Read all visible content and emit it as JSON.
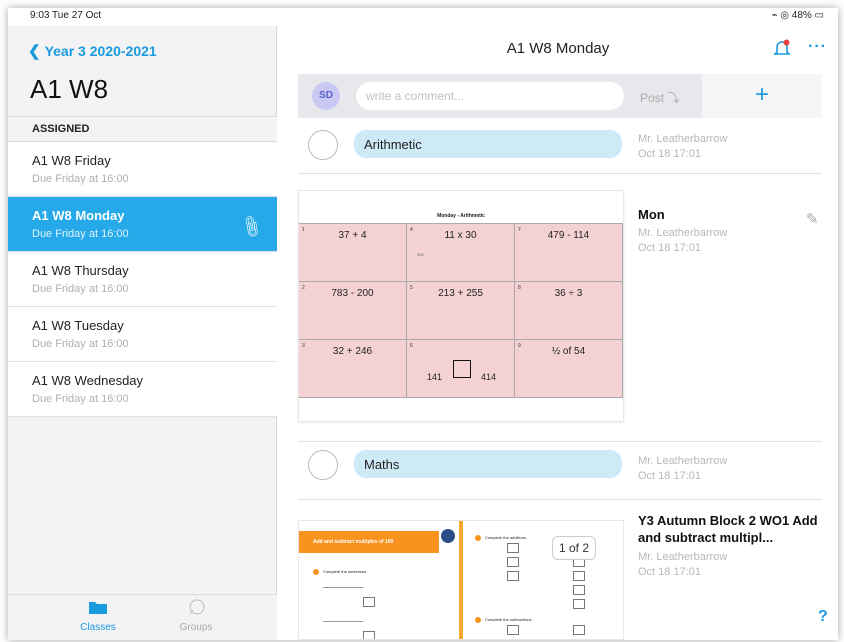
{
  "status": {
    "left": "9:03  Tue 27 Oct",
    "right": "⌁ ◎ 48% ▭"
  },
  "sidebar": {
    "back_label": "Year 3 2020-2021",
    "title": "A1 W8",
    "section_label": "ASSIGNED",
    "items": [
      {
        "title": "A1 W8 Friday",
        "due": "Due Friday at 16:00"
      },
      {
        "title": "A1 W8 Monday",
        "due": "Due Friday at 16:00"
      },
      {
        "title": "A1 W8 Thursday",
        "due": "Due Friday at 16:00"
      },
      {
        "title": "A1 W8 Tuesday",
        "due": "Due Friday at 16:00"
      },
      {
        "title": "A1 W8 Wednesday",
        "due": "Due Friday at 16:00"
      }
    ],
    "tabs": {
      "classes": "Classes",
      "groups": "Groups"
    }
  },
  "header": {
    "title": "A1 W8 Monday",
    "more": "···"
  },
  "comment": {
    "avatar": "SD",
    "placeholder": "write a comment...",
    "post": "Post ⤵",
    "plus": "+"
  },
  "posts": [
    {
      "label": "Arithmetic",
      "author": "Mr. Leatherbarrow",
      "date": "Oct 18 17:01"
    },
    {
      "title": "Mon",
      "author": "Mr. Leatherbarrow",
      "date": "Oct 18 17:01"
    },
    {
      "label": "Maths",
      "author": "Mr. Leatherbarrow",
      "date": "Oct 18 17:01"
    },
    {
      "title": "Y3 Autumn Block 2 WO1 Add and subtract multipl...",
      "author": "Mr. Leatherbarrow",
      "date": "Oct 18 17:01"
    }
  ],
  "worksheet": {
    "title": "Monday - Arithmetic",
    "cells": [
      {
        "n": "1",
        "q": "37 + 4"
      },
      {
        "n": "4",
        "q": "11 x 30",
        "sub": "330"
      },
      {
        "n": "7",
        "q": "479 - 114"
      },
      {
        "n": "2",
        "q": "783 - 200"
      },
      {
        "n": "5",
        "q": "213 + 255"
      },
      {
        "n": "8",
        "q": "36 ÷ 3"
      },
      {
        "n": "3",
        "q": "32 + 246"
      },
      {
        "n": "6",
        "a": "141",
        "b": "414"
      },
      {
        "n": "9",
        "q": "½ of 54"
      }
    ]
  },
  "maths_thumb": {
    "banner": "Add and subtract multiples of 100",
    "p1_q1": "Complete the sentences.",
    "p2_q1": "Complete the additions.",
    "p2_q2": "Complete the subtractions.",
    "pager": "1 of 2"
  },
  "help": "?",
  "colors": {
    "accent": "#1a9be0",
    "selected": "#26a9e8",
    "bubble": "#cfeaf7",
    "worksheet_bg": "#f4d2d4"
  }
}
